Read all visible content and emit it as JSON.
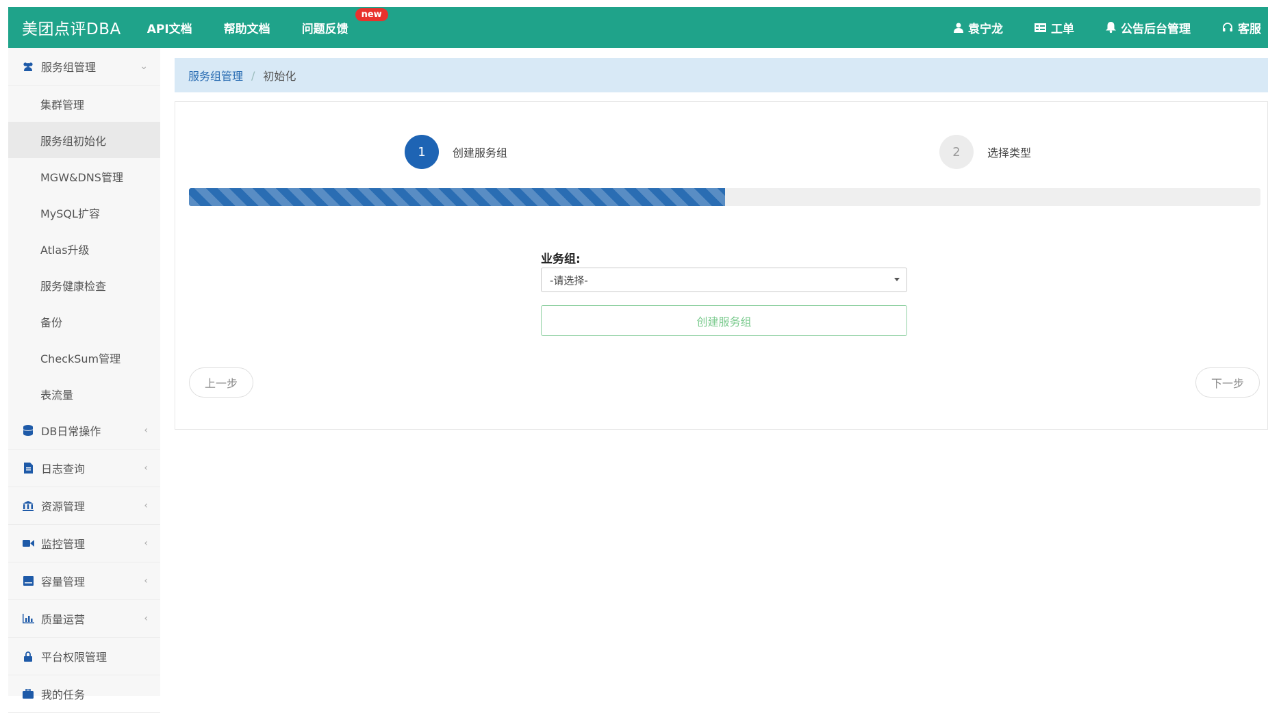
{
  "navbar": {
    "brand": "美团点评DBA",
    "links": [
      {
        "label": "API文档"
      },
      {
        "label": "帮助文档"
      },
      {
        "label": "问题反馈",
        "badge": "new"
      }
    ],
    "right": [
      {
        "icon": "user-icon",
        "label": "袁宁龙"
      },
      {
        "icon": "ticket-icon",
        "label": "工单"
      },
      {
        "icon": "bell-icon",
        "label": "公告后台管理"
      },
      {
        "icon": "headset-icon",
        "label": "客服"
      }
    ],
    "colors": {
      "bar": "#1fa38a",
      "badge": "#e8322d"
    }
  },
  "sidebar": {
    "groups": [
      {
        "icon": "users-icon",
        "label": "服务组管理",
        "expanded": true,
        "items": [
          {
            "label": "集群管理"
          },
          {
            "label": "服务组初始化",
            "active": true
          },
          {
            "label": "MGW&DNS管理"
          },
          {
            "label": "MySQL扩容"
          },
          {
            "label": "Atlas升级"
          },
          {
            "label": "服务健康检查"
          },
          {
            "label": "备份"
          },
          {
            "label": "CheckSum管理"
          },
          {
            "label": "表流量"
          }
        ]
      },
      {
        "icon": "database-icon",
        "label": "DB日常操作"
      },
      {
        "icon": "file-icon",
        "label": "日志查询"
      },
      {
        "icon": "bank-icon",
        "label": "资源管理"
      },
      {
        "icon": "video-icon",
        "label": "监控管理"
      },
      {
        "icon": "drive-icon",
        "label": "容量管理"
      },
      {
        "icon": "chart-icon",
        "label": "质量运营"
      },
      {
        "icon": "lock-icon",
        "label": "平台权限管理"
      },
      {
        "icon": "briefcase-icon",
        "label": "我的任务"
      }
    ]
  },
  "breadcrumb": {
    "parent": "服务组管理",
    "separator": "/",
    "current": "初始化"
  },
  "wizard": {
    "steps": [
      {
        "number": "1",
        "label": "创建服务组",
        "active": true
      },
      {
        "number": "2",
        "label": "选择类型",
        "active": false
      }
    ],
    "progress_percent": 50,
    "field_label": "业务组:",
    "select_value": "-请选择-",
    "create_button": "创建服务组",
    "prev_button": "上一步",
    "next_button": "下一步",
    "colors": {
      "step_active": "#1e64b4",
      "progress": "#2a6db3",
      "create_border": "#8fd0a2"
    }
  }
}
